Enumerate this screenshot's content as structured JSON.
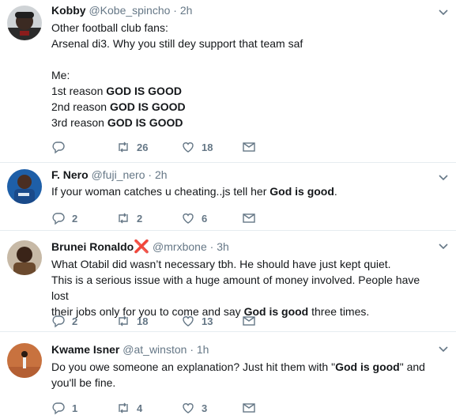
{
  "tweets": [
    {
      "name": "Kobby",
      "handle": "@Kobe_spincho",
      "dot": "·",
      "time": "2h",
      "lines": [
        [
          "Other football club fans:"
        ],
        [
          "Arsenal di3. Why you still dey support that team saf"
        ],
        [
          ""
        ],
        [
          "Me:"
        ],
        [
          "1st reason ",
          "GOD IS GOOD"
        ],
        [
          "2nd reason ",
          "GOD IS GOOD"
        ],
        [
          "3rd reason ",
          "GOD IS GOOD"
        ]
      ],
      "replies": "",
      "retweets": "26",
      "likes": "18"
    },
    {
      "name": "F. Nero",
      "handle": "@fuji_nero",
      "dot": "·",
      "time": "2h",
      "text_before": "If your woman catches u cheating..js tell her ",
      "text_bold": "God is good",
      "text_after": ".",
      "replies": "2",
      "retweets": "2",
      "likes": "6"
    },
    {
      "name": "Brunei Ronaldo",
      "name_suffix": "❌",
      "handle": "@mrxbone",
      "dot": "·",
      "time": "3h",
      "line1": "What Otabil did wasn’t necessary tbh. He should have just kept quiet.",
      "line2": "This is a serious issue with a huge amount of money involved. People have lost",
      "line3_before": "their jobs only for you to come and say ",
      "line3_bold": "God is good",
      "line3_after": " three times.",
      "replies": "2",
      "retweets": "18",
      "likes": "13"
    },
    {
      "name": "Kwame Isner",
      "handle": "@at_winston",
      "dot": "·",
      "time": "1h",
      "line1_before": "Do you owe someone an explanation? Just hit them with \"",
      "line1_bold": "God is good",
      "line1_after": "\" and",
      "line2": "you'll be fine.",
      "replies": "1",
      "retweets": "4",
      "likes": "3"
    }
  ],
  "icons": {
    "reply": "reply-icon",
    "retweet": "retweet-icon",
    "like": "heart-icon",
    "dm": "envelope-icon",
    "caret": "chevron-down-icon"
  },
  "colors": {
    "icon_gray": "#657786",
    "divider": "#e6ecf0",
    "red_x": "#e0245e"
  }
}
